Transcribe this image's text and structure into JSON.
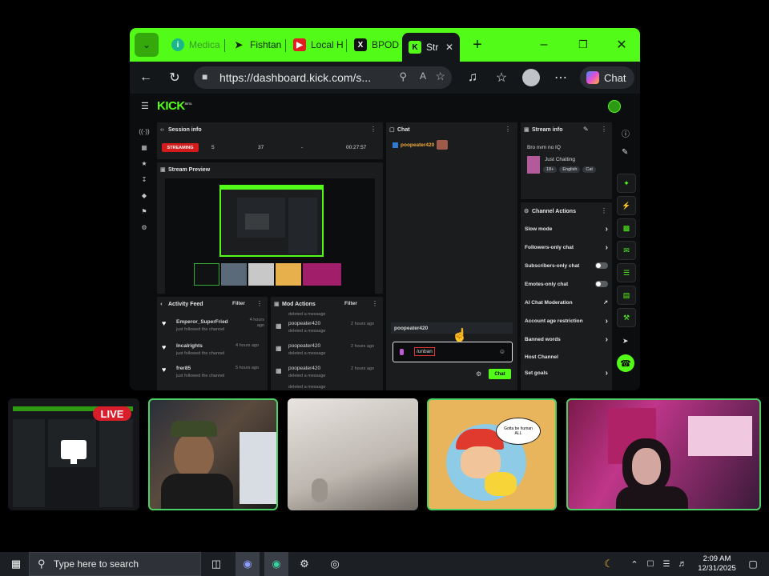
{
  "browser": {
    "tabs": [
      {
        "label": "Medica",
        "icon": "info-icon"
      },
      {
        "label": "Fishtan",
        "icon": "fish-icon"
      },
      {
        "label": "Local H",
        "icon": "youtube-icon"
      },
      {
        "label": "BPOD",
        "icon": "x-icon"
      },
      {
        "label": "Str",
        "icon": "kick-icon",
        "active": true
      }
    ],
    "url": "https://dashboard.kick.com/s...",
    "chat_label": "Chat",
    "accent": "#53fc18"
  },
  "kick": {
    "logo": "KICK",
    "logo_sup": "BETA",
    "session": {
      "title": "Session info",
      "status": "STREAMING",
      "viewers": "5",
      "followers": "37",
      "subs": "-",
      "duration": "00:27:57"
    },
    "preview_title": "Stream Preview",
    "activity": {
      "title": "Activity Feed",
      "filter": "Filter",
      "items": [
        {
          "user": "Emperor_SuperFried",
          "action": "just followed the channel",
          "time": "4 hours ago"
        },
        {
          "user": "Incalrights",
          "action": "just followed the channel",
          "time": "4 hours ago"
        },
        {
          "user": "frer85",
          "action": "just followed the channel",
          "time": "5 hours ago"
        }
      ]
    },
    "mod": {
      "title": "Mod Actions",
      "filter": "Filter",
      "top_action": "deleted a message",
      "items": [
        {
          "user": "poopeater420",
          "action": "deleted a message",
          "time": "2 hours ago"
        },
        {
          "user": "poopeater420",
          "action": "deleted a message",
          "time": "2 hours ago"
        },
        {
          "user": "poopeater420",
          "action": "deleted a message",
          "time": "2 hours ago"
        }
      ],
      "bottom_action": "deleted a message"
    },
    "chat": {
      "title": "Chat",
      "first_user": "poopeater420",
      "last_user": "poopeater420",
      "input_value": "/unban",
      "send_label": "Chat"
    },
    "stream_info": {
      "title": "Stream info",
      "stream_title": "Bro nvm no IQ",
      "category": "Just Chatting",
      "tags": [
        "18+",
        "English",
        "Cat"
      ]
    },
    "channel_actions": {
      "title": "Channel Actions",
      "items": [
        {
          "label": "Slow mode",
          "control": "arrow"
        },
        {
          "label": "Followers-only chat",
          "control": "arrow"
        },
        {
          "label": "Subscribers-only chat",
          "control": "toggle"
        },
        {
          "label": "Emotes-only chat",
          "control": "toggle"
        },
        {
          "label": "AI Chat Moderation",
          "control": "external"
        },
        {
          "label": "Account age restriction",
          "control": "arrow"
        },
        {
          "label": "Banned words",
          "control": "arrow"
        },
        {
          "label": "Host Channel",
          "control": "none"
        },
        {
          "label": "Set goals",
          "control": "arrow"
        }
      ]
    }
  },
  "overlay": {
    "live_label": "LIVE",
    "speech_bubble": "Gotta be human ALL"
  },
  "taskbar": {
    "search_placeholder": "Type here to search",
    "time": "2:09 AM",
    "date": "12/31/2025"
  }
}
